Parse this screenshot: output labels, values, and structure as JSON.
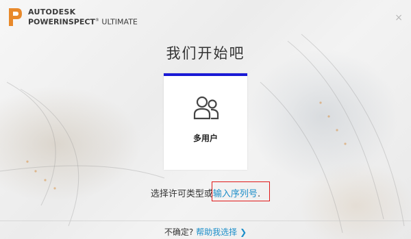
{
  "header": {
    "brand_top": "AUTODESK",
    "brand_product": "POWERINSPECT",
    "brand_edition": "ULTIMATE",
    "trademark": "®"
  },
  "window": {
    "close_label": "×"
  },
  "main": {
    "title": "我们开始吧",
    "card": {
      "label": "多用户",
      "icon": "users-icon",
      "accent_color": "#1a1ad6"
    },
    "choose_prefix": "选择许可类型或",
    "serial_link": "输入序列号",
    "choose_suffix": ".",
    "highlight_color": "#e01818"
  },
  "footer": {
    "question": "不确定?",
    "help_link": "帮助我选择",
    "chevron": "❯"
  },
  "colors": {
    "link": "#1b8ec9",
    "logo": "#e8892b"
  }
}
